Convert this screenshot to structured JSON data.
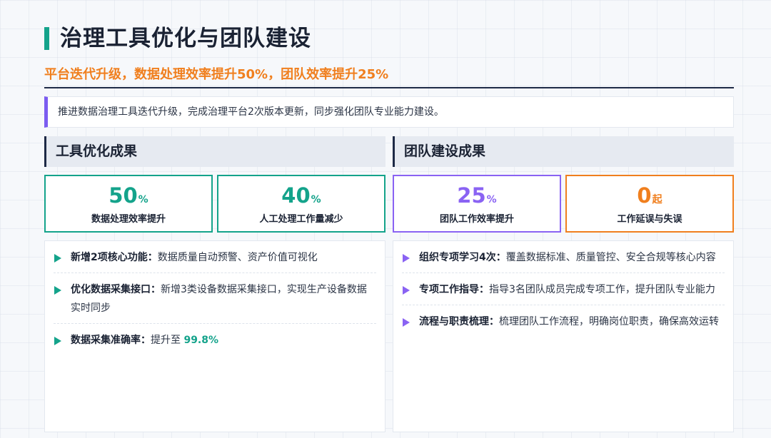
{
  "header": {
    "title": "治理工具优化与团队建设",
    "subtitle": "平台迭代升级，数据处理效率提升50%，团队效率提升25%"
  },
  "intro": "推进数据治理工具迭代升级，完成治理平台2次版本更新，同步强化团队专业能力建设。",
  "colors": {
    "teal": "#14a38b",
    "purple": "#8a63f3",
    "orange": "#f07f1e",
    "navy": "#1e2a46"
  },
  "left": {
    "heading": "工具优化成果",
    "stats": [
      {
        "value": "50",
        "unit": "%",
        "label": "数据处理效率提升",
        "color": "#14a38b"
      },
      {
        "value": "40",
        "unit": "%",
        "label": "人工处理工作量减少",
        "color": "#14a38b"
      }
    ],
    "items": [
      {
        "title": "新增2项核心功能：",
        "text": "数据质量自动预警、资产价值可视化",
        "highlight": ""
      },
      {
        "title": "优化数据采集接口：",
        "text": "新增3类设备数据采集接口，实现生产设备数据实时同步",
        "highlight": ""
      },
      {
        "title": "数据采集准确率：",
        "text": "提升至 ",
        "highlight": "99.8%"
      }
    ]
  },
  "right": {
    "heading": "团队建设成果",
    "stats": [
      {
        "value": "25",
        "unit": "%",
        "label": "团队工作效率提升",
        "color": "#8a63f3"
      },
      {
        "value": "0",
        "unit": "起",
        "label": "工作延误与失误",
        "color": "#f07f1e"
      }
    ],
    "items": [
      {
        "title": "组织专项学习4次：",
        "text": "覆盖数据标准、质量管控、安全合规等核心内容"
      },
      {
        "title": "专项工作指导：",
        "text": "指导3名团队成员完成专项工作，提升团队专业能力"
      },
      {
        "title": "流程与职责梳理：",
        "text": "梳理团队工作流程，明确岗位职责，确保高效运转"
      }
    ]
  }
}
